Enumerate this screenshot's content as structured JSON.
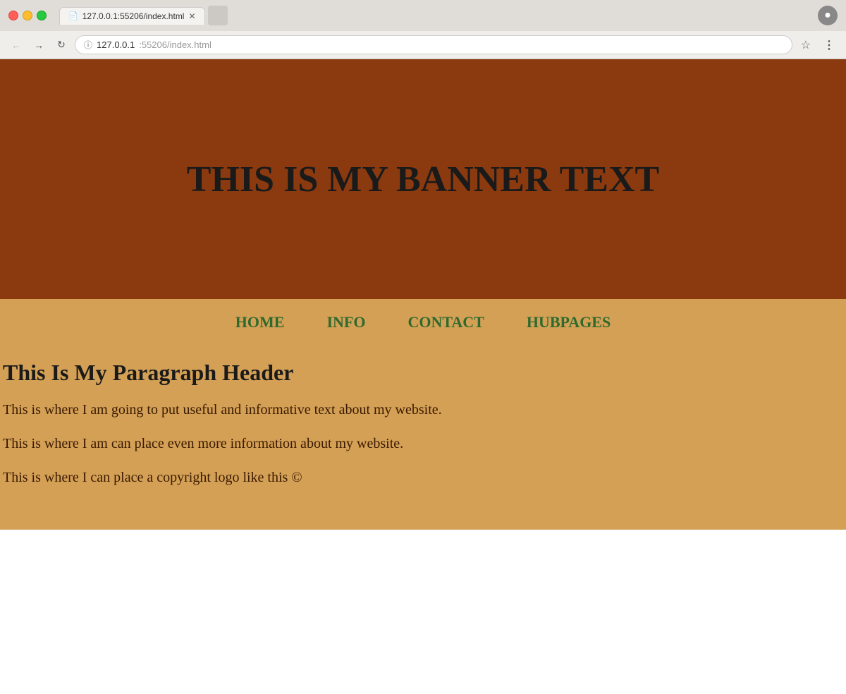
{
  "browser": {
    "url_base": "127.0.0.1",
    "url_port": ":55206/index.html",
    "tab_title": "127.0.0.1:55206/index.html"
  },
  "banner": {
    "text": "THIS IS MY BANNER TEXT"
  },
  "nav": {
    "links": [
      {
        "label": "HOME",
        "href": "#"
      },
      {
        "label": "INFO",
        "href": "#"
      },
      {
        "label": "CONTACT",
        "href": "#"
      },
      {
        "label": "HUBPAGES",
        "href": "#"
      }
    ]
  },
  "content": {
    "header": "This Is My Paragraph Header",
    "paragraph1": "This is where I am going to put useful and informative text about my website.",
    "paragraph2": "This is where I am can place even more information about my website.",
    "paragraph3": "This is where I can place a copyright logo like this ©"
  },
  "colors": {
    "banner_bg": "#8B3A0F",
    "nav_bg": "#D4A055",
    "content_bg": "#D4A055",
    "nav_link": "#2d6a2d",
    "banner_text": "#1a1a1a",
    "body_text": "#3a1a00"
  }
}
